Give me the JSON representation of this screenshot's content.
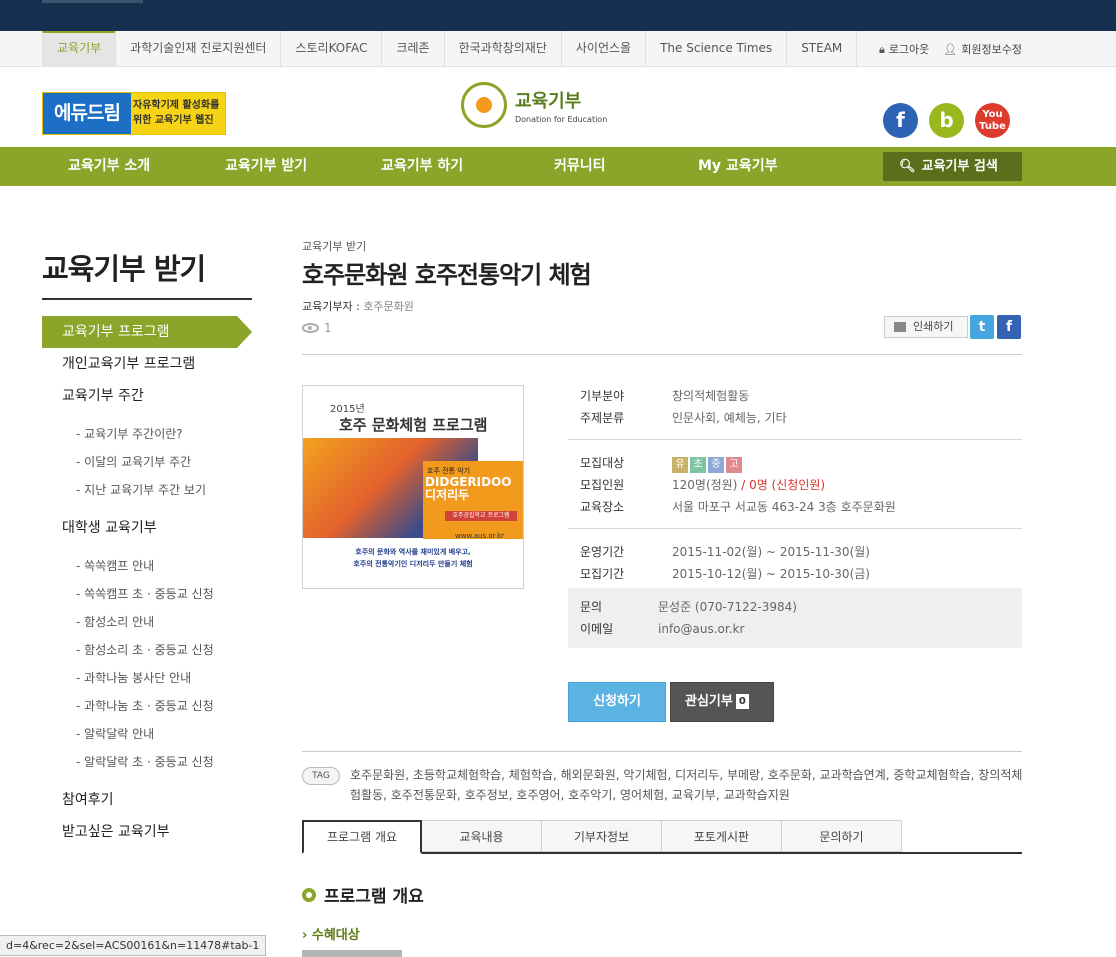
{
  "family_sites": [
    "교육기부",
    "과학기술인재 진로지원센터",
    "스토리KOFAC",
    "크레존",
    "한국과학창의재단",
    "사이언스올",
    "The Science Times",
    "STEAM"
  ],
  "util_links": {
    "logout": "로그아웃",
    "member_edit": "회원정보수정"
  },
  "banner": {
    "brand": "에듀드림",
    "line1": "자유학기제 활성화를",
    "line2": "위한 교육기부 웹진"
  },
  "logo": {
    "name": "교육기부",
    "subtitle": "Donation for Education"
  },
  "social": {
    "facebook": "f",
    "blog": "b",
    "youtube_1": "You",
    "youtube_2": "Tube"
  },
  "gnb": {
    "items": [
      "교육기부 소개",
      "교육기부 받기",
      "교육기부 하기",
      "커뮤니티",
      "My 교육기부"
    ],
    "search_label": "교육기부 검색"
  },
  "sidebar": {
    "title": "교육기부 받기",
    "menu": [
      {
        "label": "교육기부 프로그램",
        "level": 1,
        "active": true
      },
      {
        "label": "개인교육기부 프로그램",
        "level": 1
      },
      {
        "label": "교육기부 주간",
        "level": 1
      },
      {
        "label": "교육기부 주간이란?",
        "level": 2
      },
      {
        "label": "이달의 교육기부 주간",
        "level": 2
      },
      {
        "label": "지난 교육기부 주간 보기",
        "level": 2
      },
      {
        "label": "대학생 교육기부",
        "level": 1
      },
      {
        "label": "쏙쏙캠프 안내",
        "level": 2
      },
      {
        "label": "쏙쏙캠프 초 · 중등교 신청",
        "level": 2
      },
      {
        "label": "함성소리 안내",
        "level": 2
      },
      {
        "label": "함성소리 초 · 중등교 신청",
        "level": 2
      },
      {
        "label": "과학나눔 봉사단 안내",
        "level": 2
      },
      {
        "label": "과학나눔 초 · 중등교 신청",
        "level": 2
      },
      {
        "label": "알락달락 안내",
        "level": 2
      },
      {
        "label": "알락달락 초 · 중등교 신청",
        "level": 2
      },
      {
        "label": "참여후기",
        "level": 1
      },
      {
        "label": "받고싶은 교육기부",
        "level": 1
      }
    ]
  },
  "program": {
    "breadcrumb": "교육기부 받기",
    "title": "호주문화원 호주전통악기 체험",
    "donor_label": "교육기부자 :",
    "donor": "호주문화원",
    "views": "1",
    "print_label": "인쇄하기",
    "share_twitter": "t",
    "share_facebook": "f"
  },
  "poster": {
    "year": "2015년",
    "title": "호주 문화체험 프로그램",
    "sub": "호주 전통 악기",
    "name_en": "DIDGERIDOO",
    "name_ko": "디저리두",
    "pill": "호주공립학교 프로그램",
    "url": "www.aus.or.kr",
    "foot1": "호주의 문화와 역사를 재미있게 배우고,",
    "foot2": "호주의 전통악기인 디저리두 만들기 체험"
  },
  "info": {
    "field_label": "기부분야",
    "field_value": "창의적체험활동",
    "theme_label": "주제분류",
    "theme_value": "인문사회, 예체능, 기타",
    "target_label": "모집대상",
    "targets": [
      {
        "text": "유",
        "color": "#c9b26b"
      },
      {
        "text": "초",
        "color": "#7ec3a2"
      },
      {
        "text": "중",
        "color": "#8ea8d6"
      },
      {
        "text": "고",
        "color": "#e0878f"
      }
    ],
    "capacity_label": "모집인원",
    "capacity_value": "120명(정원)",
    "capacity_sep": " / ",
    "applied_value": "0명 (신청인원)",
    "place_label": "교육장소",
    "place_value": "서울 마포구 서교동 463-24 3층 호주문화원",
    "operate_label": "운영기간",
    "operate_value": "2015-11-02(월) ~ 2015-11-30(월)",
    "recruit_label": "모집기간",
    "recruit_value": "2015-10-12(월) ~ 2015-10-30(금)",
    "contact_label": "문의",
    "contact_value": "문성준 (070-7122-3984)",
    "email_label": "이메일",
    "email_value": "info@aus.or.kr"
  },
  "actions": {
    "apply": "신청하기",
    "favorite": "관심기부",
    "favorite_count": "0"
  },
  "tags": {
    "label": "TAG",
    "text": "호주문화원, 초등학교체험학습, 체험학습, 해외문화원, 악기체험, 디저리두, 부메랑, 호주문화, 교과학습연계, 중학교체험학습, 창의적체험활동, 호주전통문화, 호주정보, 호주영어, 호주악기, 영어체험, 교육기부, 교과학습지원"
  },
  "tabs": [
    "프로그램 개요",
    "교육내용",
    "기부자정보",
    "포토게시판",
    "문의하기"
  ],
  "overview": {
    "title": "프로그램 개요",
    "subtitle": "수혜대상"
  },
  "status_url": "d=4&rec=2&sel=ACS00161&n=11478#tab-1",
  "colors": {
    "brand_green": "#8aa52a",
    "top_navy": "#14304e",
    "apply_blue": "#5bb3e4",
    "alert_red": "#d9342b"
  }
}
